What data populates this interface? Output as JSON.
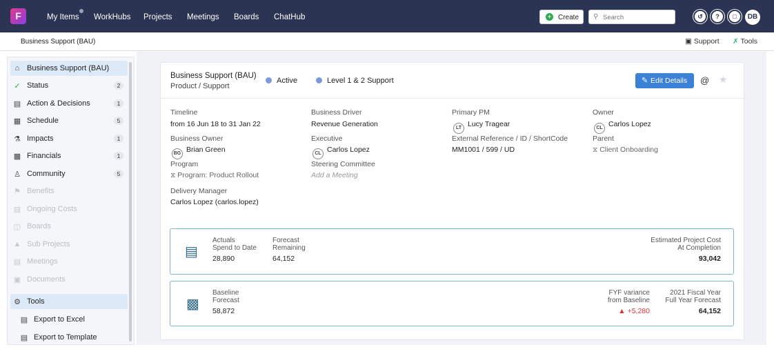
{
  "app": {
    "logo_letter": "F",
    "nav": [
      "My Items",
      "WorkHubs",
      "Projects",
      "Meetings",
      "Boards",
      "ChatHub"
    ],
    "create_label": "Create",
    "search_placeholder": "Search",
    "user_initials": "DB"
  },
  "subheader": {
    "breadcrumb": "Business Support (BAU)",
    "support_label": "Support",
    "tools_label": "Tools"
  },
  "sidebar": {
    "items": [
      {
        "label": "Business Support (BAU)",
        "icon": "home-icon",
        "count": ""
      },
      {
        "label": "Status",
        "icon": "check-circle-icon",
        "count": "2"
      },
      {
        "label": "Action & Decisions",
        "icon": "clipboard-icon",
        "count": "1"
      },
      {
        "label": "Schedule",
        "icon": "calendar-icon",
        "count": "5"
      },
      {
        "label": "Impacts",
        "icon": "impacts-icon",
        "count": "1"
      },
      {
        "label": "Financials",
        "icon": "chart-icon",
        "count": "1"
      },
      {
        "label": "Community",
        "icon": "people-icon",
        "count": "5"
      },
      {
        "label": "Benefits",
        "icon": "flag-icon",
        "count": ""
      },
      {
        "label": "Ongoing Costs",
        "icon": "wallet-icon",
        "count": ""
      },
      {
        "label": "Boards",
        "icon": "board-icon",
        "count": ""
      },
      {
        "label": "Sub Projects",
        "icon": "folder-icon",
        "count": ""
      },
      {
        "label": "Meetings",
        "icon": "meeting-icon",
        "count": ""
      },
      {
        "label": "Documents",
        "icon": "document-icon",
        "count": ""
      },
      {
        "label": "Tools",
        "icon": "gear-icon",
        "count": ""
      },
      {
        "label": "Export to Excel",
        "icon": "excel-icon",
        "count": ""
      },
      {
        "label": "Export to Template",
        "icon": "word-icon",
        "count": ""
      }
    ]
  },
  "project": {
    "title": "Business Support (BAU)",
    "category": "Product / Support",
    "status": "Active",
    "level": "Level 1 & 2 Support",
    "edit_label": "Edit Details"
  },
  "details": {
    "timeline_label": "Timeline",
    "timeline_value": "from 16 Jun 18 to 31 Jan 22",
    "business_owner_label": "Business Owner",
    "business_owner_initials": "BG",
    "business_owner_value": "Brian Green",
    "program_label": "Program",
    "program_value": "Program: Product Rollout",
    "delivery_manager_label": "Delivery Manager",
    "delivery_manager_value": "Carlos Lopez (carlos.lopez)",
    "business_driver_label": "Business Driver",
    "business_driver_value": "Revenue Generation",
    "executive_label": "Executive",
    "executive_initials": "CL",
    "executive_value": "Carlos Lopez",
    "steering_label": "Steering Committee",
    "steering_value": "Add a Meeting",
    "primary_pm_label": "Primary PM",
    "primary_pm_initials": "LT",
    "primary_pm_value": "Lucy Tragear",
    "ext_ref_label": "External Reference / ID / ShortCode",
    "ext_ref_value": "MM1001 / 599 / UD",
    "owner_label": "Owner",
    "owner_initials": "CL",
    "owner_value": "Carlos Lopez",
    "parent_label": "Parent",
    "parent_value": "Client Onboarding"
  },
  "financials": {
    "actuals_label_1": "Actuals",
    "actuals_label_2": "Spend to Date",
    "actuals_value": "28,890",
    "forecast_label_1": "Forecast",
    "forecast_label_2": "Remaining",
    "forecast_value": "64,152",
    "eac_label_1": "Estimated Project Cost",
    "eac_label_2": "At Completion",
    "eac_value": "93,042",
    "baseline_label_1": "Baseline",
    "baseline_label_2": "Forecast",
    "baseline_value": "58,872",
    "fyf_label_1": "FYF variance",
    "fyf_label_2": "from Baseline",
    "fyf_value": "+5,280",
    "fy_label_1": "2021 Fiscal Year",
    "fy_label_2": "Full Year Forecast",
    "fy_value": "64,152"
  }
}
